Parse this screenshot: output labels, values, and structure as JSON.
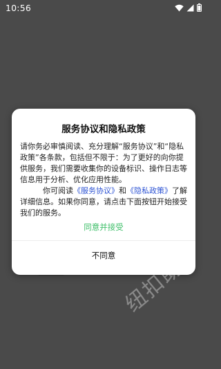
{
  "status_bar": {
    "time": "10:56",
    "icons": [
      "wifi-icon",
      "signal-icon",
      "battery-icon"
    ]
  },
  "dialog": {
    "title": "服务协议和隐私政策",
    "paragraph1": "请你务必审慎阅读、充分理解“服务协议”和“隐私政策”各条款，包括但不限于：为了更好的向你提供服务，我们需要收集你的设备标识、操作日志等信息用于分析、优化应用性能。",
    "paragraph2_prefix": "你可阅读",
    "service_link": "《服务协议》",
    "and_text": "和",
    "privacy_link": "《隐私政策》",
    "paragraph2_suffix": "了解详细信息。如果你同意，请点击下面按钮开始接受我们的服务。",
    "agree_label": "同意并接受",
    "disagree_label": "不同意"
  },
  "watermark": "纽扣助手",
  "colors": {
    "background": "#4a4a4a",
    "agree": "#3fbf6a",
    "link": "#2f55d4"
  }
}
